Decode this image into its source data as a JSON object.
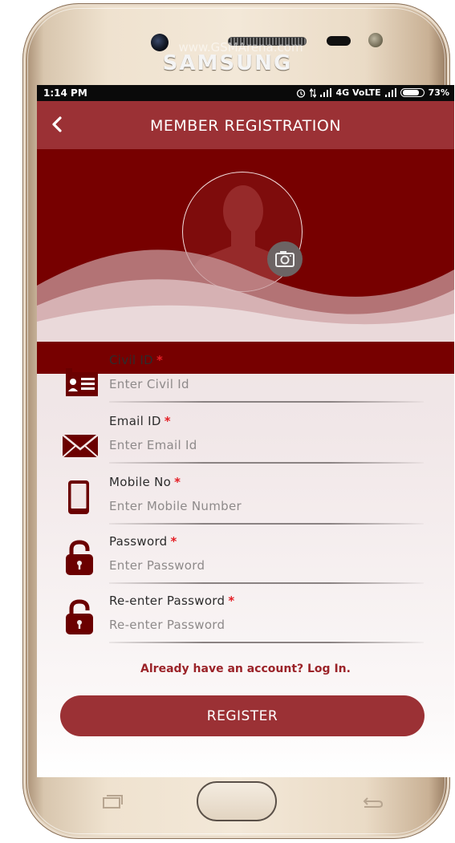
{
  "device": {
    "brand": "SAMSUNG",
    "watermark": "www.GSMArena.com"
  },
  "status_bar": {
    "time": "1:14 PM",
    "network": "4G VoLTE",
    "battery": "73%"
  },
  "app_bar": {
    "title": "MEMBER REGISTRATION"
  },
  "fields": [
    {
      "label": "Civil ID",
      "required": "*",
      "placeholder": "Enter Civil Id",
      "icon": "id-card-icon"
    },
    {
      "label": "Email ID",
      "required": "*",
      "placeholder": "Enter Email Id",
      "icon": "envelope-icon"
    },
    {
      "label": "Mobile No",
      "required": "*",
      "placeholder": "Enter Mobile Number",
      "icon": "mobile-phone-icon"
    },
    {
      "label": "Password",
      "required": "*",
      "placeholder": "Enter Password",
      "icon": "unlock-icon"
    },
    {
      "label": "Re-enter Password",
      "required": "*",
      "placeholder": "Re-enter Password",
      "icon": "unlock-icon"
    }
  ],
  "login_link": "Already have an account? Log In.",
  "register_button": "REGISTER",
  "colors": {
    "appbar": "#9b3135",
    "hero": "#770000",
    "accent": "#9b2329",
    "required": "#e41e25"
  }
}
